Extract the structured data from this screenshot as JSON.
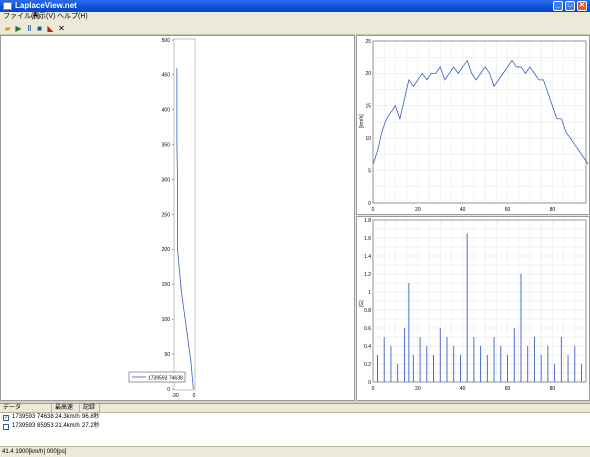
{
  "window": {
    "title": "LaplaceView.net",
    "icon": "app-icon",
    "min_glyph": "_",
    "max_glyph": "□",
    "close_glyph": "✕"
  },
  "menu": {
    "file": "ファイル(F)",
    "view": "表示(V)",
    "help": "ヘルプ(H)"
  },
  "toolbar": {
    "icons": [
      "open-folder-icon",
      "play-icon",
      "pause-icon",
      "stop-icon",
      "graph-icon",
      "delete-icon"
    ]
  },
  "left_chart": {
    "legend": "1739593 74638",
    "y_ticks": [
      "0",
      "50",
      "100",
      "150",
      "200",
      "250",
      "300",
      "350",
      "400",
      "450",
      "500"
    ],
    "x_ticks": [
      "-30",
      "0"
    ]
  },
  "chart_data": [
    {
      "type": "line",
      "x": [
        -1,
        -3,
        -5,
        -8,
        -11,
        -14,
        -17,
        -20,
        -22,
        -24,
        -26,
        -26,
        -26,
        -27,
        -27,
        -27
      ],
      "y": [
        0,
        20,
        40,
        60,
        80,
        100,
        120,
        140,
        160,
        180,
        200,
        250,
        300,
        350,
        400,
        460
      ],
      "xlim": [
        -30,
        0
      ],
      "ylim": [
        0,
        500
      ],
      "series_name": "1739593 74638",
      "x_ticks": [
        "-30",
        "0"
      ],
      "y_ticks": [
        "0",
        "50",
        "100",
        "150",
        "200",
        "250",
        "300",
        "350",
        "400",
        "450",
        "500"
      ],
      "legend": "bottom",
      "grid": false
    },
    {
      "type": "line",
      "ylabel": "[km/h]",
      "x": [
        0,
        2,
        4,
        6,
        8,
        10,
        12,
        14,
        16,
        18,
        20,
        22,
        24,
        26,
        28,
        30,
        32,
        34,
        36,
        38,
        40,
        42,
        44,
        46,
        48,
        50,
        52,
        54,
        56,
        58,
        60,
        62,
        64,
        66,
        68,
        70,
        72,
        74,
        76,
        78,
        80,
        82,
        84,
        86,
        88,
        90,
        92,
        94,
        96
      ],
      "y": [
        6,
        8,
        11,
        13,
        14,
        15,
        13,
        16,
        19,
        18,
        19,
        20,
        19,
        20,
        20,
        21,
        19,
        20,
        21,
        20,
        21,
        22,
        20,
        19,
        20,
        21,
        20,
        18,
        19,
        20,
        21,
        22,
        21,
        21,
        20,
        21,
        20,
        19,
        19,
        17,
        15,
        13,
        13,
        11,
        10,
        9,
        8,
        7,
        6
      ],
      "xlim": [
        0,
        95
      ],
      "ylim": [
        0,
        25
      ],
      "x_ticks": [
        "0",
        "20",
        "40",
        "60",
        "80"
      ],
      "y_ticks": [
        "0",
        "5",
        "10",
        "15",
        "20",
        "25"
      ],
      "grid": true
    },
    {
      "type": "bar",
      "ylabel": "[G]",
      "x": [
        2,
        5,
        8,
        11,
        14,
        16,
        18,
        21,
        24,
        27,
        30,
        33,
        36,
        39,
        42,
        45,
        48,
        51,
        54,
        57,
        60,
        63,
        66,
        69,
        72,
        75,
        78,
        81,
        84,
        87,
        90,
        93
      ],
      "values": [
        0.3,
        0.5,
        0.4,
        0.2,
        0.6,
        1.1,
        0.3,
        0.5,
        0.4,
        0.3,
        0.6,
        0.5,
        0.4,
        0.3,
        1.65,
        0.5,
        0.4,
        0.3,
        0.5,
        0.4,
        0.3,
        0.6,
        1.2,
        0.4,
        0.5,
        0.3,
        0.4,
        0.2,
        0.5,
        0.3,
        0.4,
        0.2
      ],
      "xlim": [
        0,
        95
      ],
      "ylim": [
        0,
        1.8
      ],
      "x_ticks": [
        "0",
        "20",
        "40",
        "60",
        "80"
      ],
      "y_ticks": [
        "0",
        "0.2",
        "0.4",
        "0.6",
        "0.8",
        "1",
        "1.2",
        "1.4",
        "1.6",
        "1.8"
      ],
      "grid": true
    }
  ],
  "grid": {
    "headers": [
      "データ",
      "最高速",
      "記録"
    ],
    "rows": [
      {
        "checked": true,
        "data": "1739593 74638",
        "max_speed": "24.3km/h",
        "record": "96.8秒"
      },
      {
        "checked": false,
        "data": "1739593 85953",
        "max_speed": "21.4km/h",
        "record": "27.2秒"
      }
    ]
  },
  "status": {
    "text": "41.4 1900[km/h] 000[ps]"
  }
}
